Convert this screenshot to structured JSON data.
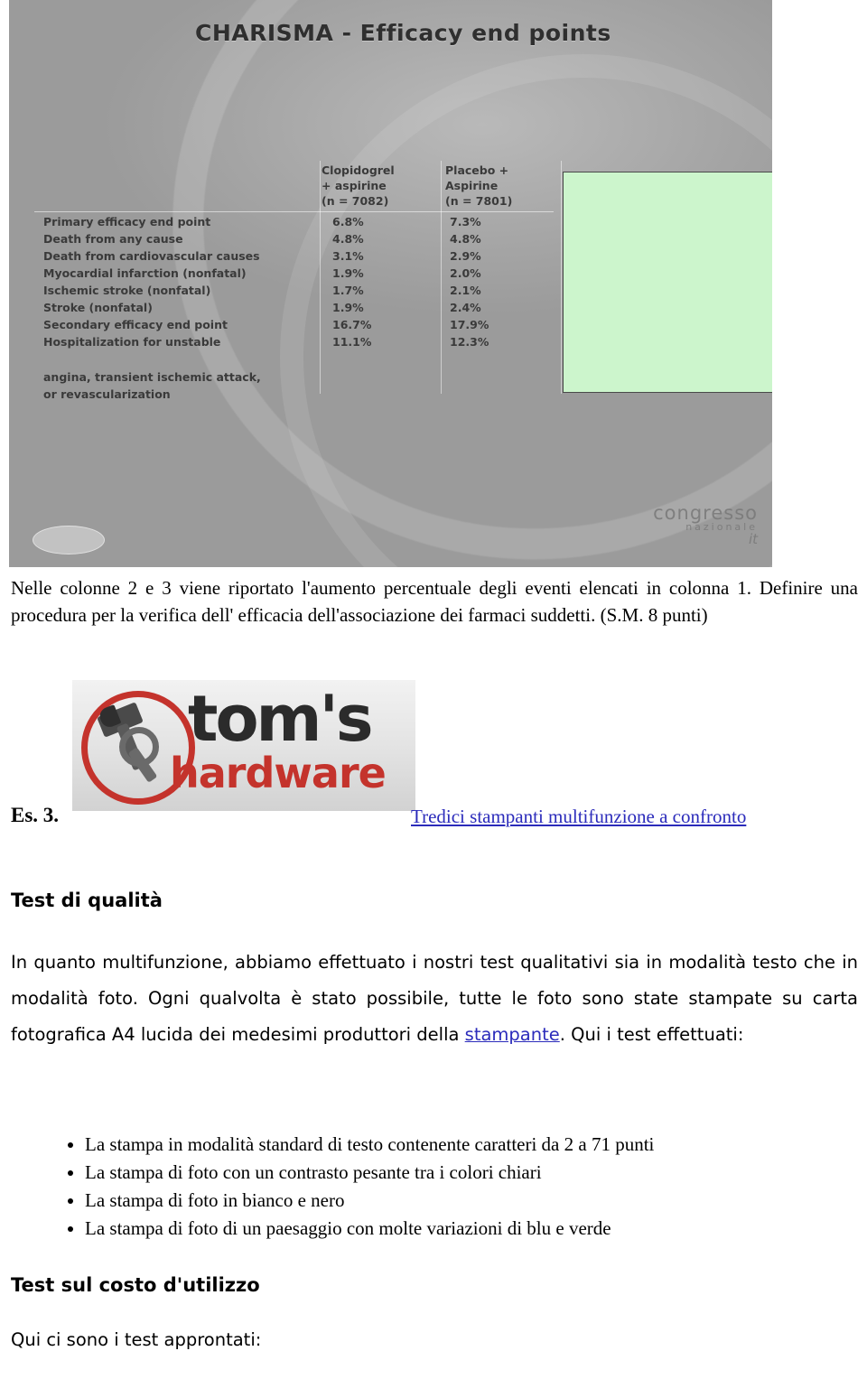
{
  "slide": {
    "title": "CHARISMA - Efficacy end points",
    "columns": {
      "col1_line1": "Clopidogrel",
      "col1_line2": "+ aspirine",
      "col1_line3": "(n = 7082)",
      "col2_line1": "Placebo  +",
      "col2_line2": "Aspirine",
      "col2_line3": "(n = 7801)"
    },
    "rows": [
      {
        "label": "Primary efficacy end point",
        "c1": "6.8%",
        "c2": "7.3%"
      },
      {
        "label": "Death from any cause",
        "c1": "4.8%",
        "c2": "4.8%"
      },
      {
        "label": "Death from cardiovascular causes",
        "c1": "3.1%",
        "c2": "2.9%"
      },
      {
        "label": "Myocardial infarction (nonfatal)",
        "c1": "1.9%",
        "c2": "2.0%"
      },
      {
        "label": "Ischemic stroke (nonfatal)",
        "c1": "1.7%",
        "c2": "2.1%"
      },
      {
        "label": "Stroke (nonfatal)",
        "c1": "1.9%",
        "c2": "2.4%"
      },
      {
        "label": "Secondary efficacy end point",
        "c1": "16.7%",
        "c2": "17.9%"
      },
      {
        "label": "Hospitalization for unstable",
        "c1": "11.1%",
        "c2": "12.3%"
      }
    ],
    "wrap_lines": [
      "angina, transient ischemic attack,",
      "or revascularization"
    ],
    "watermark": {
      "line1": "congresso",
      "line2": "nazionale",
      "line3": "it"
    }
  },
  "document": {
    "paragraph1": "Nelle colonne 2 e 3 viene riportato l'aumento percentuale degli eventi elencati in colonna 1. Definire una procedura per la verifica dell' efficacia dell'associazione dei farmaci suddetti. (S.M. 8 punti)",
    "exercise_label": "Es. 3.",
    "toms_logo": {
      "word1": "tom's",
      "word2": "hardware"
    },
    "toms_link": "Tredici stampanti multifunzione a confronto",
    "section_quality": "Test di qualità",
    "intro_part1": "In quanto multifunzione, abbiamo effettuato i nostri test qualitativi sia in modalità testo che in modalità foto. Ogni qualvolta è stato possibile, tutte le foto sono state stampate su carta fotografica A4 lucida dei medesimi produttori della ",
    "intro_link": "stampante",
    "intro_part2": ". Qui i test effettuati:",
    "bullets": [
      "La stampa in modalità standard di testo contenente caratteri da 2 a 71 punti",
      "La stampa di foto con un contrasto pesante tra i colori chiari",
      "La stampa di foto in bianco e nero",
      "La stampa di foto di un paesaggio con molte variazioni di blu e verde"
    ],
    "section_cost": "Test sul costo d'utilizzo",
    "closing": "Qui ci sono i test approntati:"
  }
}
